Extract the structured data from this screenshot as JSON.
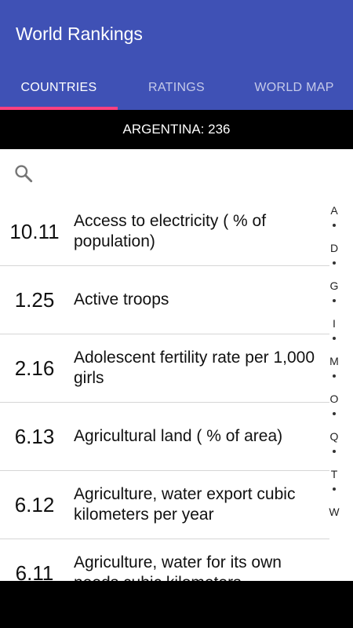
{
  "app": {
    "title": "World Rankings",
    "colors": {
      "primary": "#3f51b5",
      "accent": "#ff4081"
    }
  },
  "tabs": [
    {
      "label": "COUNTRIES",
      "active": true
    },
    {
      "label": "RATINGS",
      "active": false
    },
    {
      "label": "WORLD MAP",
      "active": false
    }
  ],
  "selected_country": {
    "text": "ARGENTINA: 236"
  },
  "search": {
    "icon": "search-icon"
  },
  "rankings": [
    {
      "value": "10.11",
      "label": "Access to electricity ( % of population)"
    },
    {
      "value": "1.25",
      "label": "Active troops"
    },
    {
      "value": "2.16",
      "label": "Adolescent fertility rate per 1,000 girls"
    },
    {
      "value": "6.13",
      "label": "Agricultural land ( % of area)"
    },
    {
      "value": "6.12",
      "label": "Agriculture, water export cubic kilometers per year"
    },
    {
      "value": "6.11",
      "label": "Agriculture, water for its own needs cubic kilometers"
    }
  ],
  "alpha_index": [
    "A",
    "D",
    "G",
    "I",
    "M",
    "O",
    "Q",
    "T",
    "W"
  ]
}
